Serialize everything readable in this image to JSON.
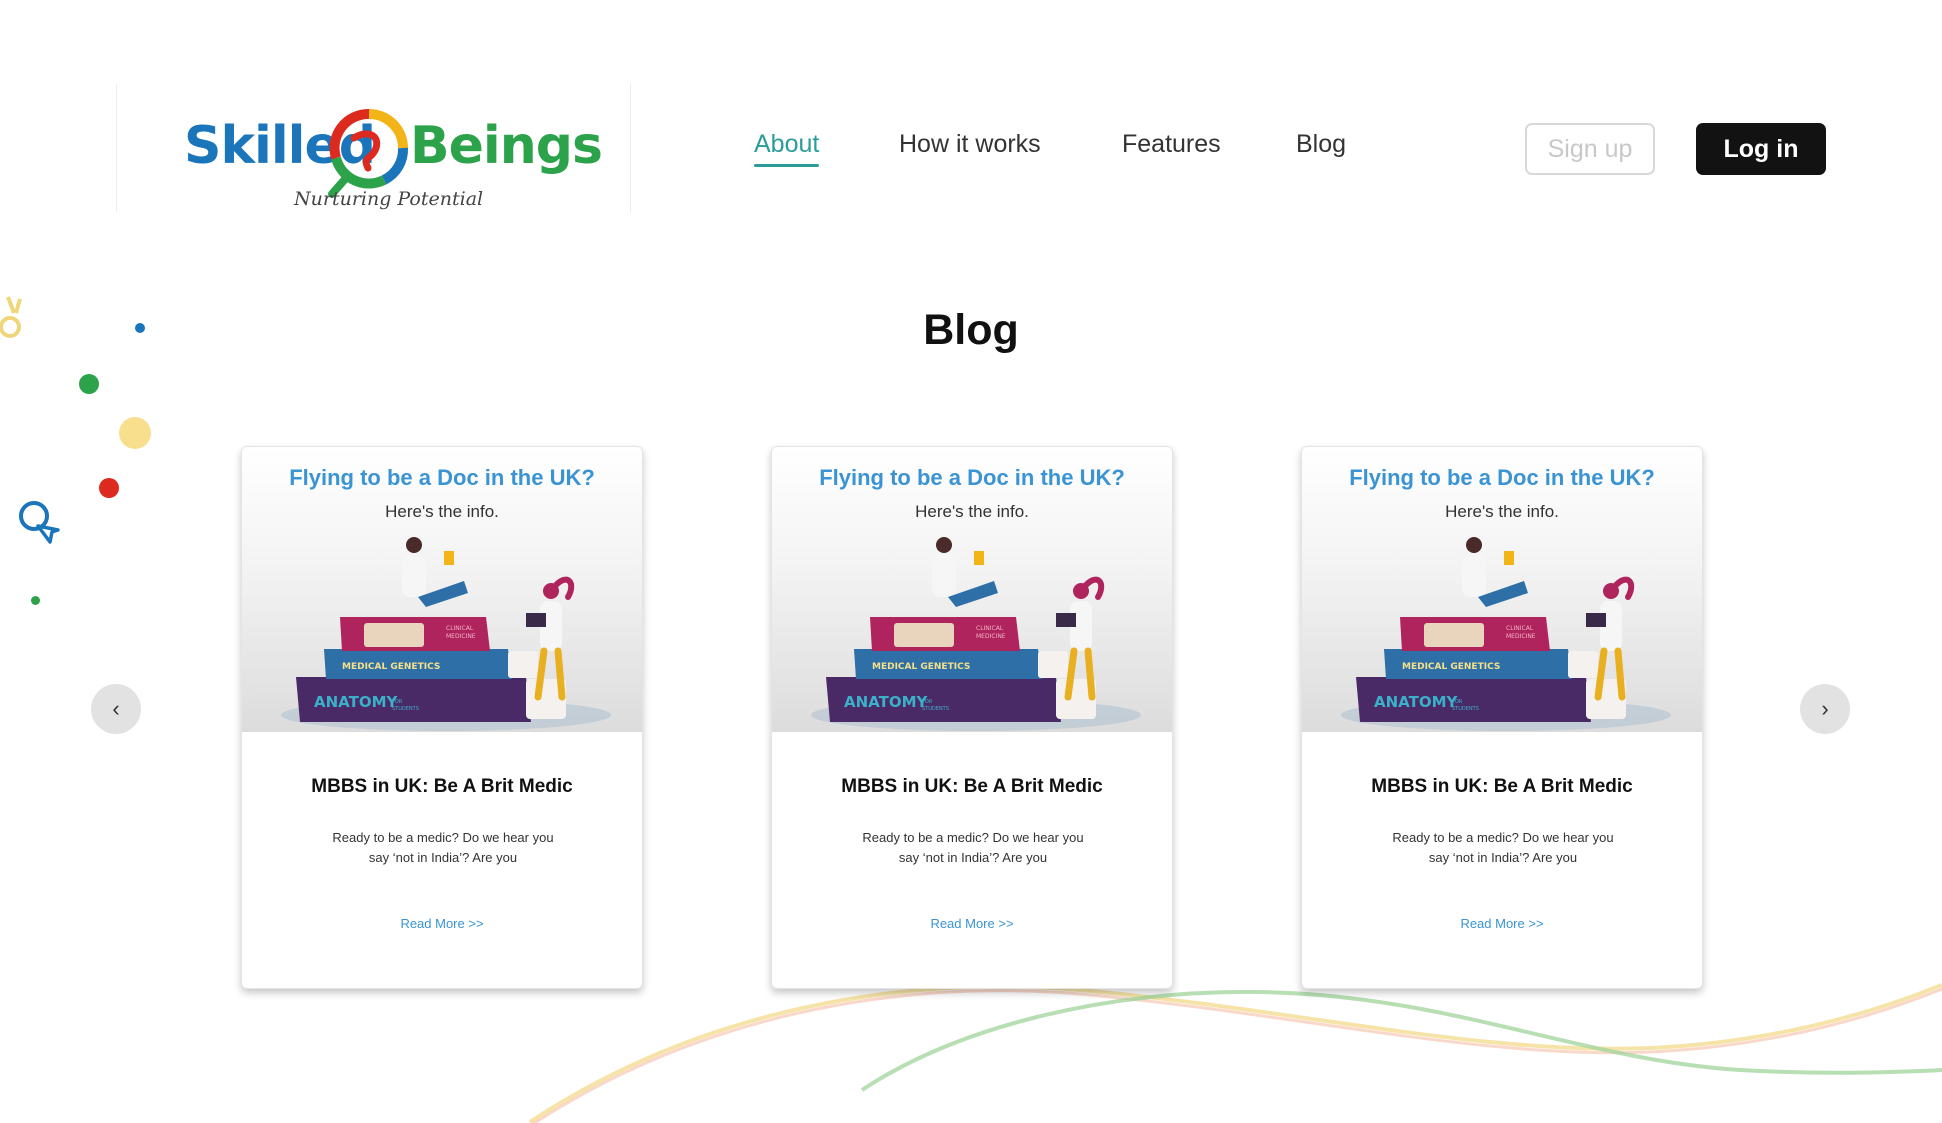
{
  "brand": {
    "name_part1": "Skilled",
    "name_part2": "Beings",
    "tagline": "Nurturing Potential"
  },
  "nav": {
    "items": [
      {
        "label": "About",
        "active": true
      },
      {
        "label": "How it works",
        "active": false
      },
      {
        "label": "Features",
        "active": false
      },
      {
        "label": "Blog",
        "active": false
      }
    ],
    "signup_label": "Sign up",
    "login_label": "Log in"
  },
  "section": {
    "title": "Blog"
  },
  "carousel": {
    "prev_icon": "‹",
    "next_icon": "›",
    "cards": [
      {
        "image_title": "Flying to be a Doc in the UK?",
        "image_subtitle": "Here's the info.",
        "book_labels": [
          "CLINICAL",
          "MEDICINE",
          "MEDICAL GENETICS",
          "ANATOMY",
          "FOR",
          "STUDENTS"
        ],
        "title": "MBBS in UK: Be A Brit Medic",
        "excerpt": "Ready to be a medic? Do we hear you say ‘not in India’? Are you",
        "link": "Read More >>"
      },
      {
        "image_title": "Flying to be a Doc in the UK?",
        "image_subtitle": "Here's the info.",
        "book_labels": [
          "CLINICAL",
          "MEDICINE",
          "MEDICAL GENETICS",
          "ANATOMY",
          "FOR",
          "STUDENTS"
        ],
        "title": "MBBS in UK: Be A Brit Medic",
        "excerpt": "Ready to be a medic? Do we hear you say ‘not in India’? Are you",
        "link": "Read More >>"
      },
      {
        "image_title": "Flying to be a Doc in the UK?",
        "image_subtitle": "Here's the info.",
        "book_labels": [
          "CLINICAL",
          "MEDICINE",
          "MEDICAL GENETICS",
          "ANATOMY",
          "FOR",
          "STUDENTS"
        ],
        "title": "MBBS in UK: Be A Brit Medic",
        "excerpt": "Ready to be a medic? Do we hear you say ‘not in India’? Are you",
        "link": "Read More >>"
      }
    ]
  },
  "colors": {
    "accent_teal": "#2a9d9a",
    "brand_blue": "#1a75bb",
    "brand_green": "#2ca34a",
    "link_blue": "#3a94d4",
    "login_bg": "#121212"
  }
}
